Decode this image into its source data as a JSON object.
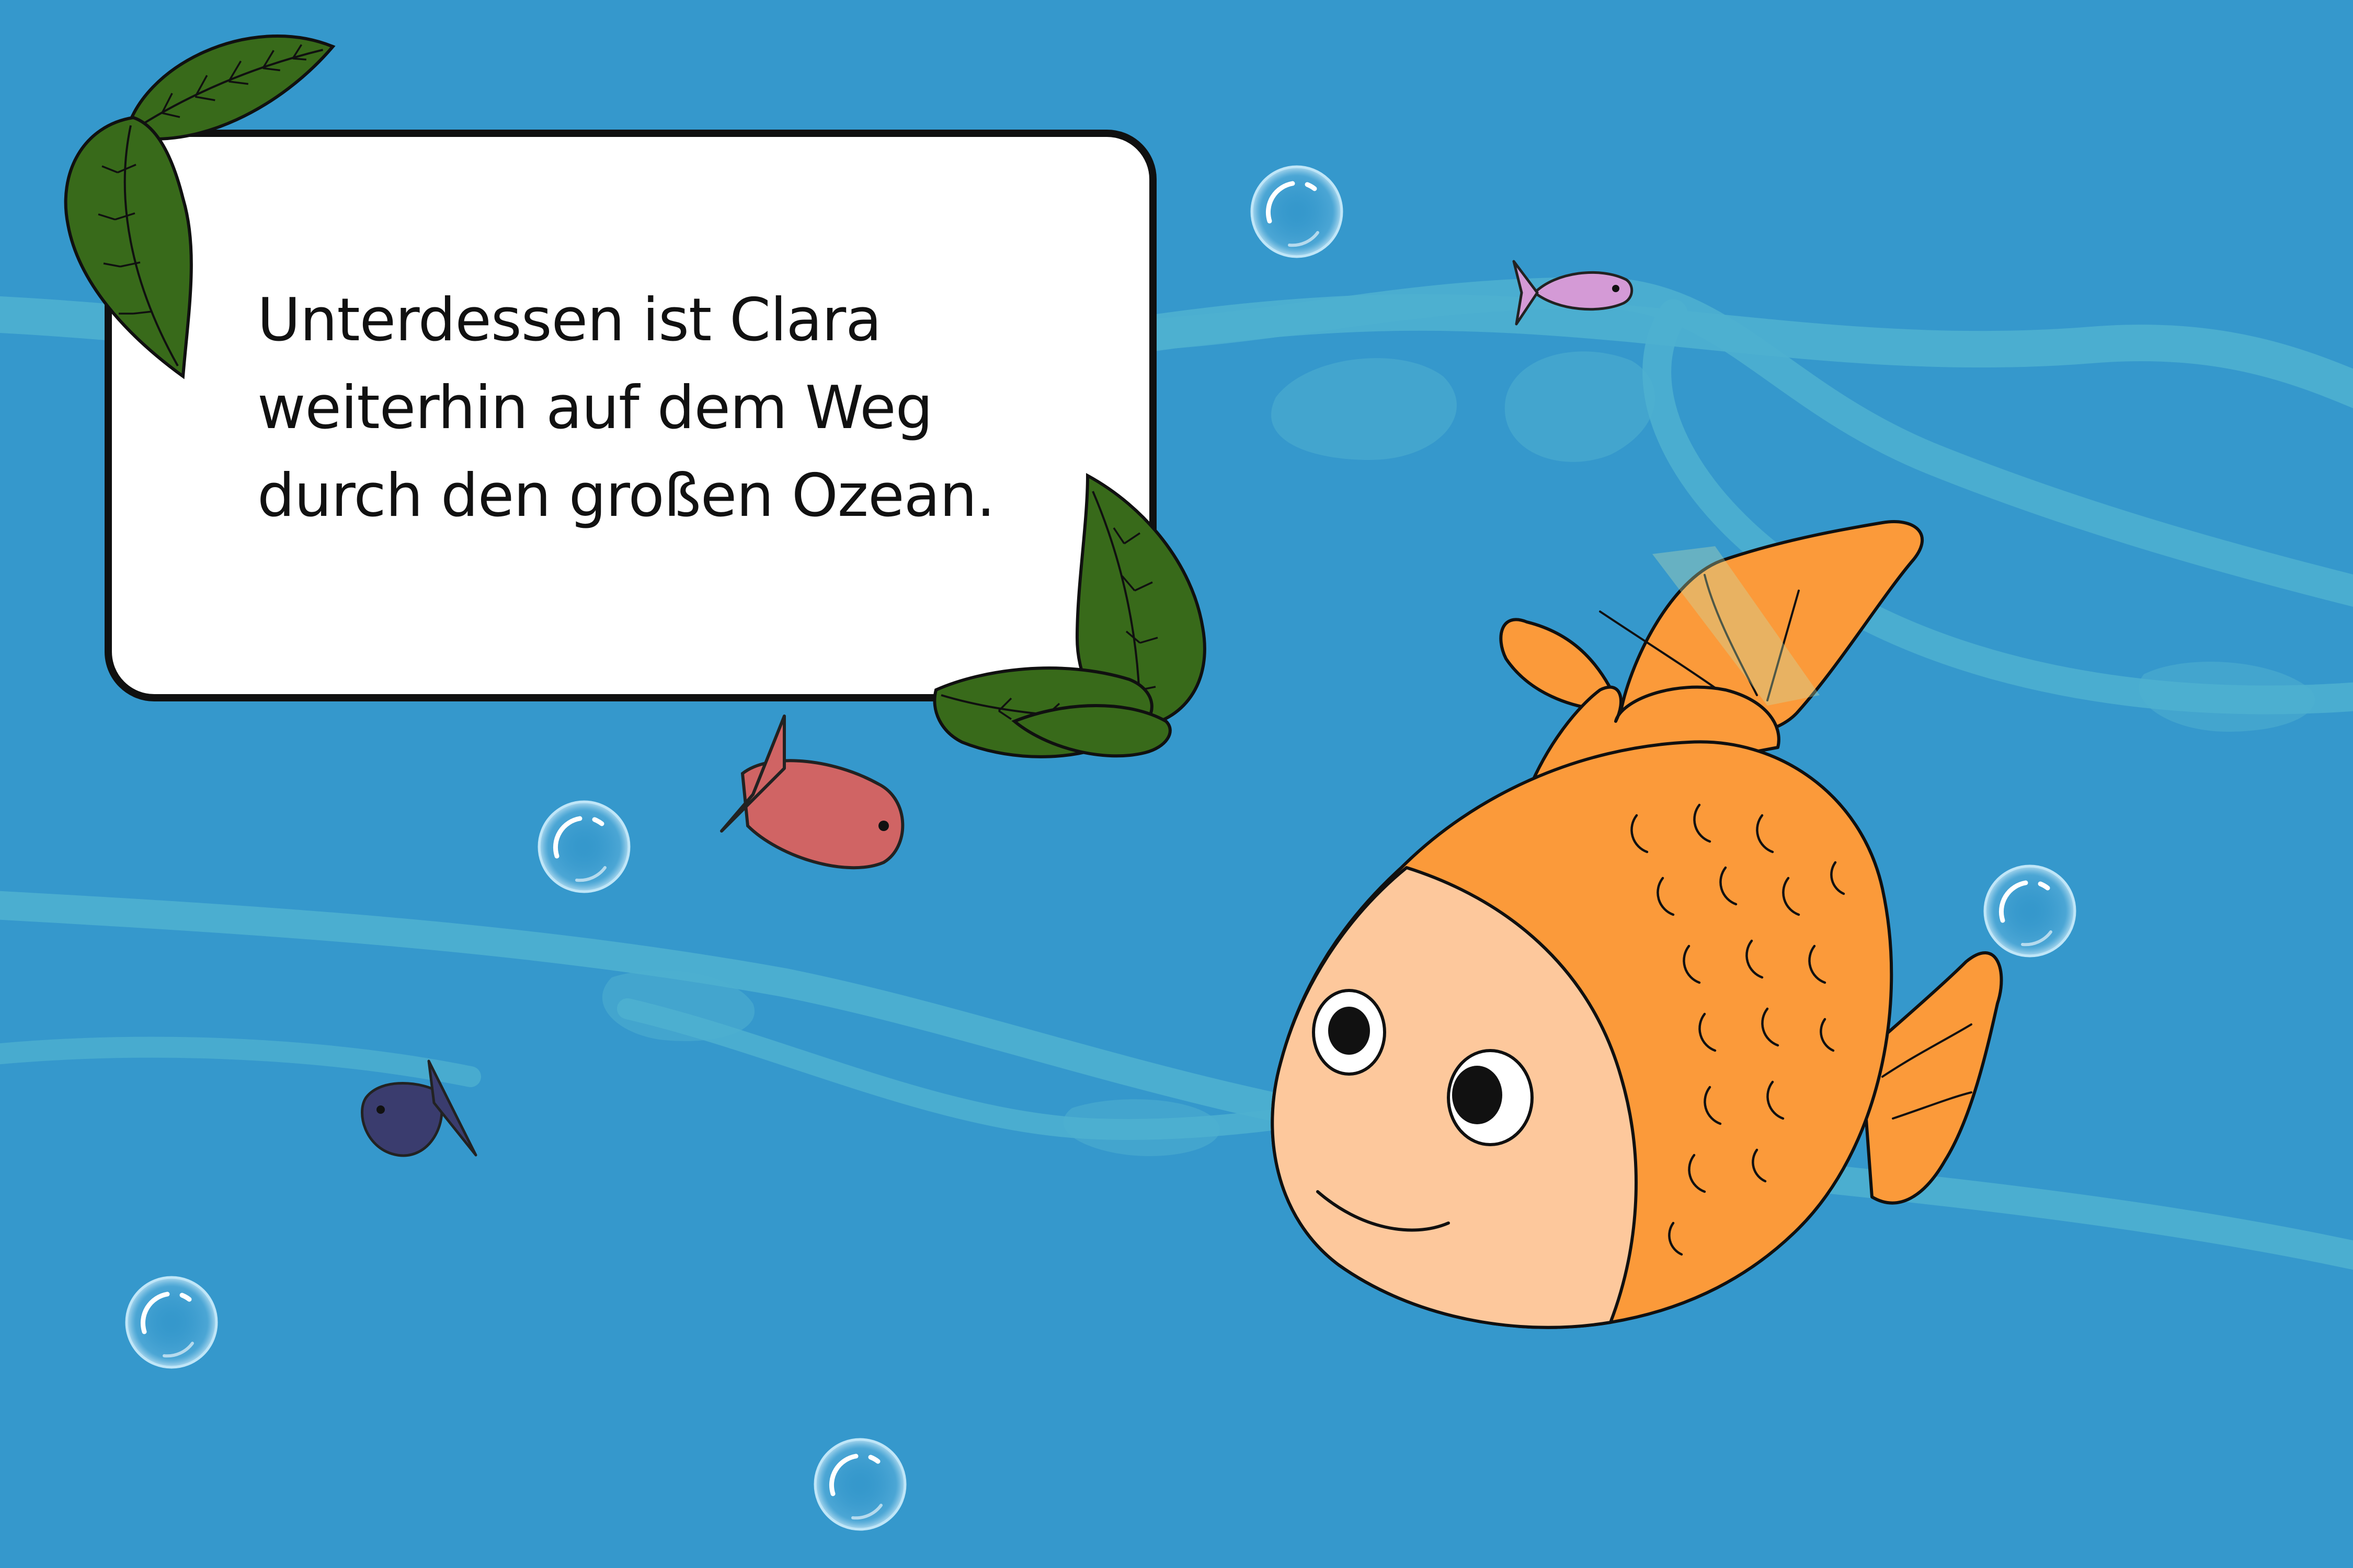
{
  "story": {
    "lines": [
      "Unterdessen ist Clara",
      "weiterhin auf dem Weg",
      "durch den großen Ozean."
    ]
  },
  "colors": {
    "ocean": "#3598cc",
    "current": "#4eb0d0",
    "leaf": "#386a1a",
    "goldfish_body": "#fb9a3a",
    "goldfish_face": "#fdc89c",
    "fish_red": "#d06464",
    "fish_purple": "#d49ad6",
    "fish_navy": "#3a3c6e"
  },
  "scene": {
    "main_character": "goldfish",
    "small_fish": [
      "red-fish",
      "purple-fish",
      "navy-fish"
    ],
    "decorations": [
      "leaf-cluster-top-left",
      "leaf-cluster-bottom-right",
      "air-bubbles"
    ]
  }
}
